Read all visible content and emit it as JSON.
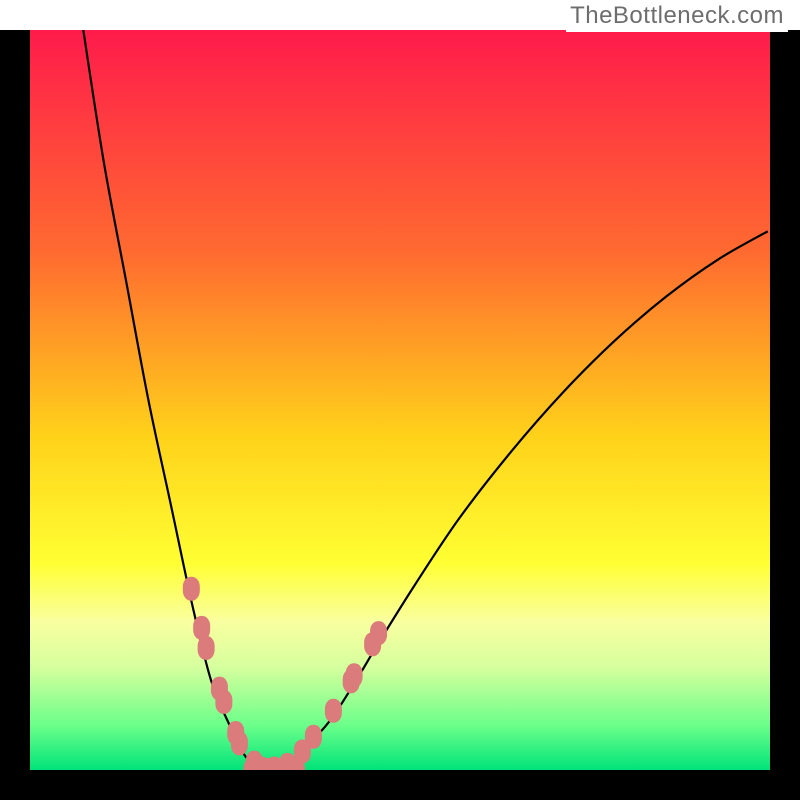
{
  "watermark": "TheBottleneck.com",
  "chart_data": {
    "type": "line",
    "title": "",
    "xlabel": "",
    "ylabel": "",
    "xlim": [
      0,
      1
    ],
    "ylim": [
      0,
      1
    ],
    "background": {
      "type": "vertical-gradient",
      "stops": [
        {
          "offset": 0.0,
          "color": "#ff1b4b"
        },
        {
          "offset": 0.3,
          "color": "#ff6a30"
        },
        {
          "offset": 0.55,
          "color": "#ffd21a"
        },
        {
          "offset": 0.72,
          "color": "#ffff33"
        },
        {
          "offset": 0.8,
          "color": "#f9ffa0"
        },
        {
          "offset": 0.86,
          "color": "#d7ff9e"
        },
        {
          "offset": 0.94,
          "color": "#6bff8a"
        },
        {
          "offset": 1.0,
          "color": "#00e379"
        }
      ]
    },
    "series": [
      {
        "name": "bottleneck-curve",
        "color": "#000000",
        "x": [
          0.072,
          0.1,
          0.13,
          0.16,
          0.19,
          0.22,
          0.245,
          0.27,
          0.29,
          0.305,
          0.315,
          0.325,
          0.335,
          0.345,
          0.4,
          0.44,
          0.47,
          0.52,
          0.58,
          0.65,
          0.72,
          0.79,
          0.86,
          0.93,
          0.997
        ],
        "y": [
          1.0,
          0.82,
          0.66,
          0.5,
          0.36,
          0.22,
          0.12,
          0.06,
          0.02,
          0.005,
          0.0,
          0.0,
          0.0,
          0.005,
          0.06,
          0.12,
          0.17,
          0.25,
          0.34,
          0.43,
          0.51,
          0.58,
          0.64,
          0.69,
          0.728
        ]
      },
      {
        "name": "highlight-dots-left",
        "type": "scatter",
        "color": "#db7b7b",
        "marker": "round-rect",
        "x": [
          0.218,
          0.232,
          0.238,
          0.256,
          0.262,
          0.278,
          0.283,
          0.303,
          0.313
        ],
        "y": [
          0.245,
          0.192,
          0.165,
          0.11,
          0.092,
          0.05,
          0.036,
          0.01,
          0.002
        ]
      },
      {
        "name": "highlight-dots-right",
        "type": "scatter",
        "color": "#db7b7b",
        "marker": "round-rect",
        "x": [
          0.33,
          0.348,
          0.368,
          0.383,
          0.41,
          0.434,
          0.438,
          0.463,
          0.471
        ],
        "y": [
          0.002,
          0.007,
          0.025,
          0.045,
          0.08,
          0.12,
          0.128,
          0.17,
          0.185
        ]
      },
      {
        "name": "highlight-dots-bottom",
        "type": "scatter",
        "color": "#db7b7b",
        "marker": "round-rect",
        "x": [
          0.3,
          0.31,
          0.322,
          0.336,
          0.348,
          0.36
        ],
        "y": [
          0.0,
          0.0,
          0.0,
          0.0,
          0.0,
          0.0
        ]
      }
    ]
  }
}
